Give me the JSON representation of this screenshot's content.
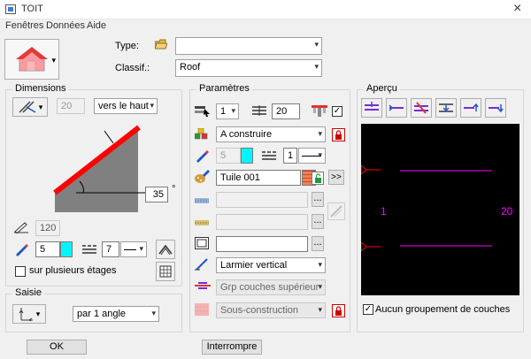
{
  "window": {
    "title": "TOIT",
    "close_glyph": "×"
  },
  "menu": {
    "items": [
      "Fenêtres",
      "Données",
      "Aide"
    ]
  },
  "header": {
    "type_label": "Type:",
    "type_value": "",
    "classif_label": "Classif.:",
    "classif_value": "Roof"
  },
  "dimensions": {
    "title": "Dimensions",
    "angle_value": "20",
    "direction": "vers le haut",
    "angle_field": "35",
    "angle_unit": "°",
    "thickness": "120",
    "pen": "5",
    "line": "7",
    "multi_level_label": "sur plusieurs étages",
    "multi_level_checked": false
  },
  "saisie": {
    "title": "Saisie",
    "mode": "par 1 angle"
  },
  "parametres": {
    "title": "Paramètres",
    "layer_value": "1",
    "count_value": "20",
    "top_checked": true,
    "status": "A construire",
    "pen2": "5",
    "line2": "1",
    "material": "Tuile 001",
    "more_glyph": ">>",
    "dots_glyph": "...",
    "hatch": "Larmier vertical",
    "group": "Grp couches supérieur",
    "subconstruction": "Sous-construction"
  },
  "apercu": {
    "title": "Aperçu",
    "left_label": "1",
    "right_label": "20",
    "no_group_label": "Aucun groupement de couches",
    "no_group_checked": true,
    "colors": {
      "bg": "#000000",
      "layer": "#ff00ff",
      "marker": "#ff0000"
    }
  },
  "footer": {
    "ok": "OK",
    "interrupt": "Interrompre"
  }
}
